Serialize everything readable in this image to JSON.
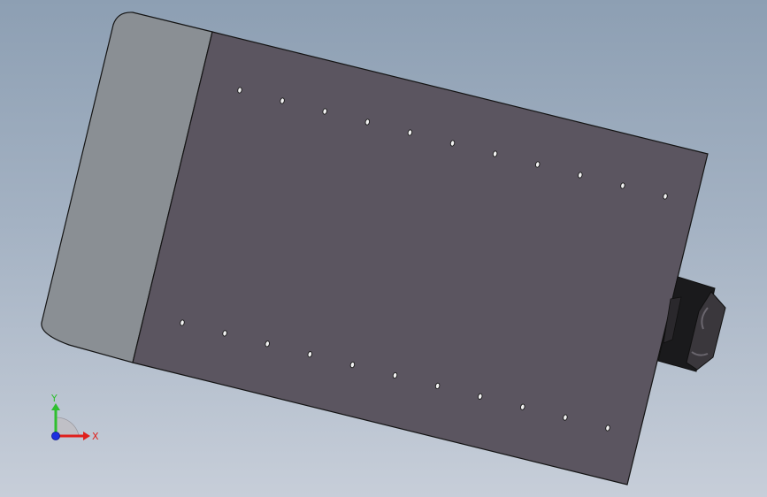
{
  "viewport": {
    "background_top": "#8d9fb3",
    "background_bottom": "#c7ced9"
  },
  "model": {
    "end_cap_color": "#8a8f94",
    "body_color": "#5b5560",
    "edge_color": "#141414",
    "connector_color": "#3a373c",
    "hole_rows": 2,
    "holes_per_row": 11
  },
  "triad": {
    "x_label": "X",
    "y_label": "Y",
    "x_color": "#e0201c",
    "y_color": "#2fbf2f",
    "z_color": "#1c2fe0"
  }
}
